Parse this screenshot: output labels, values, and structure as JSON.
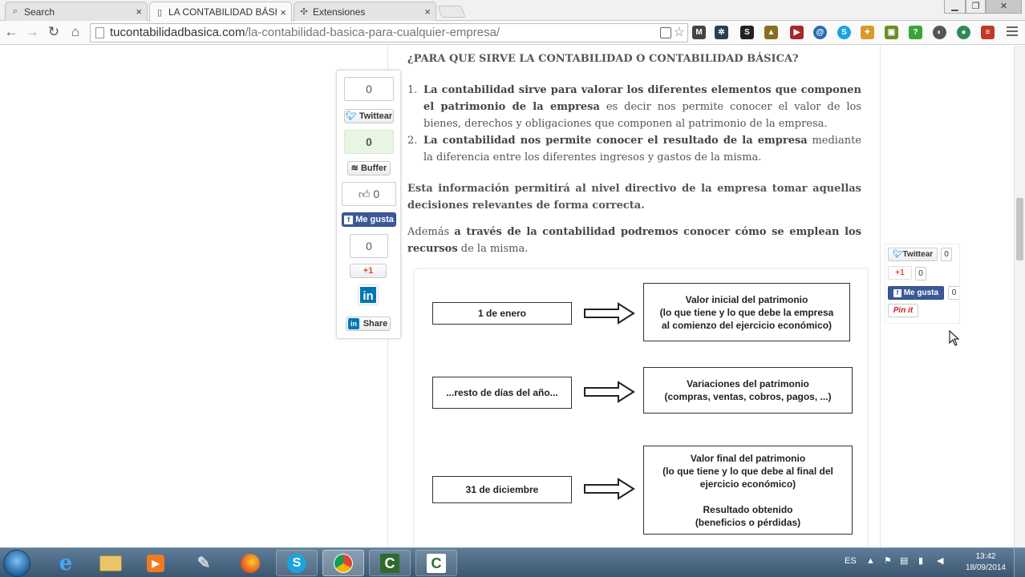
{
  "browser": {
    "tabs": [
      {
        "label": "Search",
        "icon": "search-icon",
        "active": false
      },
      {
        "label": "LA CONTABILIDAD BÁSIC",
        "icon": "page-icon",
        "active": true
      },
      {
        "label": "Extensiones",
        "icon": "puzzle-icon",
        "active": false
      }
    ],
    "close_glyph": "×",
    "url_domain": "tucontabilidadbasica.com",
    "url_path": "/la-contabilidad-basica-para-cualquier-empresa/"
  },
  "article": {
    "heading": "¿PARA QUE SIRVE LA CONTABILIDAD O CONTABILIDAD BÁSICA?",
    "list": [
      {
        "num": "1.",
        "bold": "La contabilidad sirve para valorar los diferentes elementos que componen el patrimonio de la empresa",
        "rest": " es decir nos permite conocer el valor de los bienes, derechos y obligaciones que componen al patrimonio de la empresa."
      },
      {
        "num": "2.",
        "bold": "La contabilidad nos permite conocer el resultado de la empresa",
        "rest": " mediante la diferencia entre los diferentes ingresos y gastos de la misma."
      }
    ],
    "para1": "Esta información permitirá al nivel directivo de la empresa tomar aquellas decisiones relevantes de forma correcta.",
    "para2_pre": "Además ",
    "para2_bold": "a través de la contabilidad podremos conocer cómo se emplean los recursos",
    "para2_post": " de la misma."
  },
  "diagram": {
    "rows": [
      {
        "left": "1 de enero",
        "right": "Valor inicial del patrimonio\n(lo que tiene y lo que debe la empresa\nal comienzo del ejercicio económico)"
      },
      {
        "left": "...resto de días del año...",
        "right": "Variaciones del patrimonio\n(compras, ventas, cobros, pagos, ...)"
      },
      {
        "left": "31 de diciembre",
        "right": "Valor final del patrimonio\n(lo que tiene y lo que debe al final del\nejercicio económico)\n\nResultado obtenido\n(beneficios o pérdidas)"
      }
    ]
  },
  "share_left": {
    "twitter_count": "0",
    "twitter_label": "Twittear",
    "buffer_count": "0",
    "buffer_label": "Buffer",
    "like_count": "0",
    "like_label": "Me gusta",
    "gplus_count": "0",
    "gplus_label": "+1",
    "linkedin_label": "in",
    "share_label": "Share"
  },
  "share_right": {
    "twitter_label": "Twittear",
    "twitter_count": "0",
    "gplus_label": "+1",
    "gplus_count": "0",
    "like_label": "Me gusta",
    "like_count": "0",
    "pinit_label": "Pin it"
  },
  "taskbar": {
    "lang": "ES",
    "time": "13:42",
    "date": "18/09/2014"
  },
  "colors": {
    "facebook": "#3b5998",
    "twitter": "#55acee",
    "linkedin": "#0077b5",
    "gplus": "#dd4b39",
    "pinterest": "#cb2027"
  }
}
